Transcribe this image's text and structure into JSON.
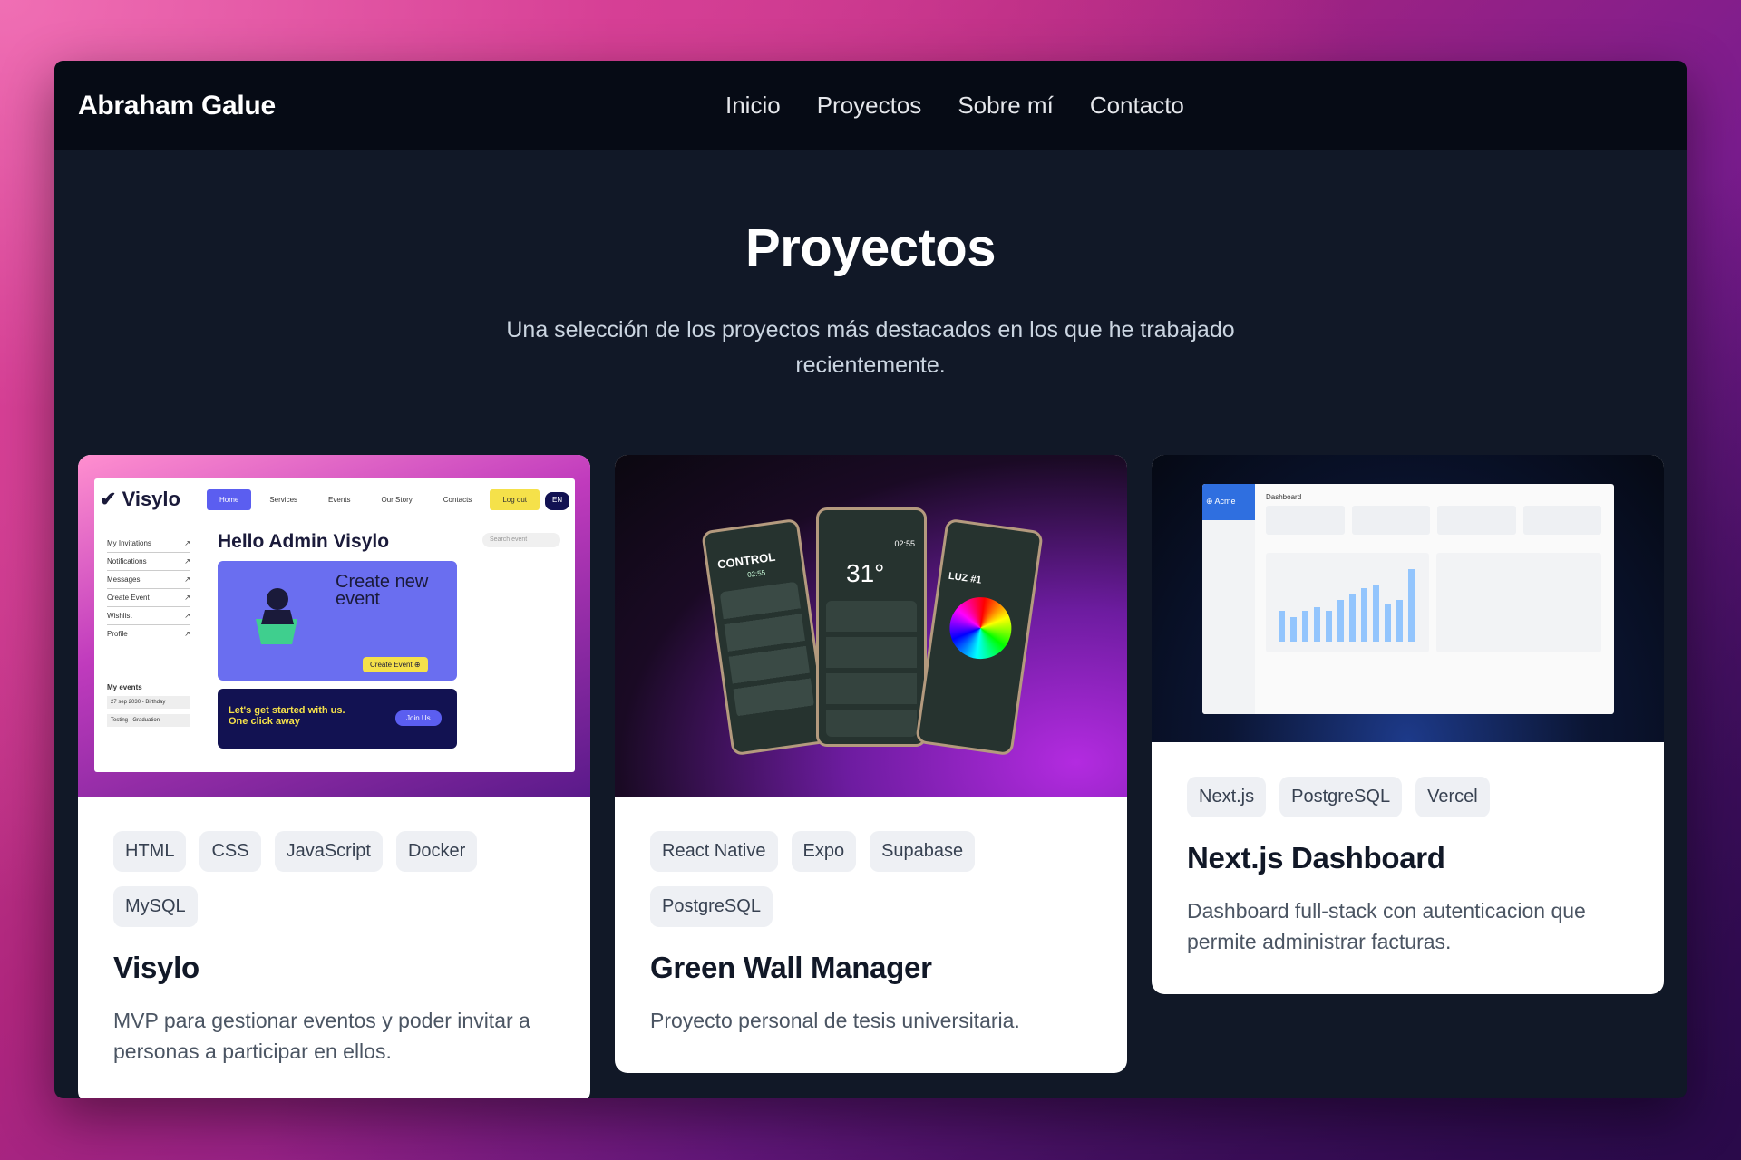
{
  "nav": {
    "brand": "Abraham Galue",
    "links": [
      "Inicio",
      "Proyectos",
      "Sobre mí",
      "Contacto"
    ]
  },
  "hero": {
    "title": "Proyectos",
    "subtitle": "Una selección de los proyectos más destacados en los que he trabajado recientemente."
  },
  "projects": [
    {
      "tags": [
        "HTML",
        "CSS",
        "JavaScript",
        "Docker",
        "MySQL"
      ],
      "title": "Visylo",
      "description": "MVP para gestionar eventos y poder invitar a personas a participar en ellos.",
      "preview": {
        "logo": "Visylo",
        "nav": [
          "Home",
          "Services",
          "Events",
          "Our Story",
          "Contacts",
          "Log out",
          "EN"
        ],
        "sidebar": [
          "My Invitations",
          "Notifications",
          "Messages",
          "Create Event",
          "Wishlist",
          "Profile"
        ],
        "my_events_label": "My events",
        "events": [
          "27 sep 2030 - Birthday",
          "Testing - Graduation"
        ],
        "greeting": "Hello Admin Visylo",
        "search_placeholder": "Search event",
        "create_title": "Create new event",
        "create_button": "Create Event",
        "banner_text": "Let's get started with us. One click away",
        "banner_button": "Join Us"
      }
    },
    {
      "tags": [
        "React Native",
        "Expo",
        "Supabase",
        "PostgreSQL"
      ],
      "title": "Green Wall Manager",
      "description": "Proyecto personal de tesis universitaria.",
      "preview": {
        "left_screen": "CONTROL",
        "left_time": "02:55",
        "center_temp": "31°",
        "center_time": "02:55",
        "right_screen": "LUZ #1"
      }
    },
    {
      "tags": [
        "Next.js",
        "PostgreSQL",
        "Vercel"
      ],
      "title": "Next.js Dashboard",
      "description": "Dashboard full-stack con autenticacion que permite administrar facturas.",
      "preview": {
        "logo": "Acme",
        "heading": "Dashboard",
        "bars": [
          30,
          24,
          30,
          33,
          30,
          40,
          46,
          52,
          54,
          36,
          40,
          70
        ]
      }
    }
  ],
  "colors": {
    "window_bg": "#111827",
    "nav_bg": "#060b15",
    "tag_bg": "#eef0f4"
  }
}
